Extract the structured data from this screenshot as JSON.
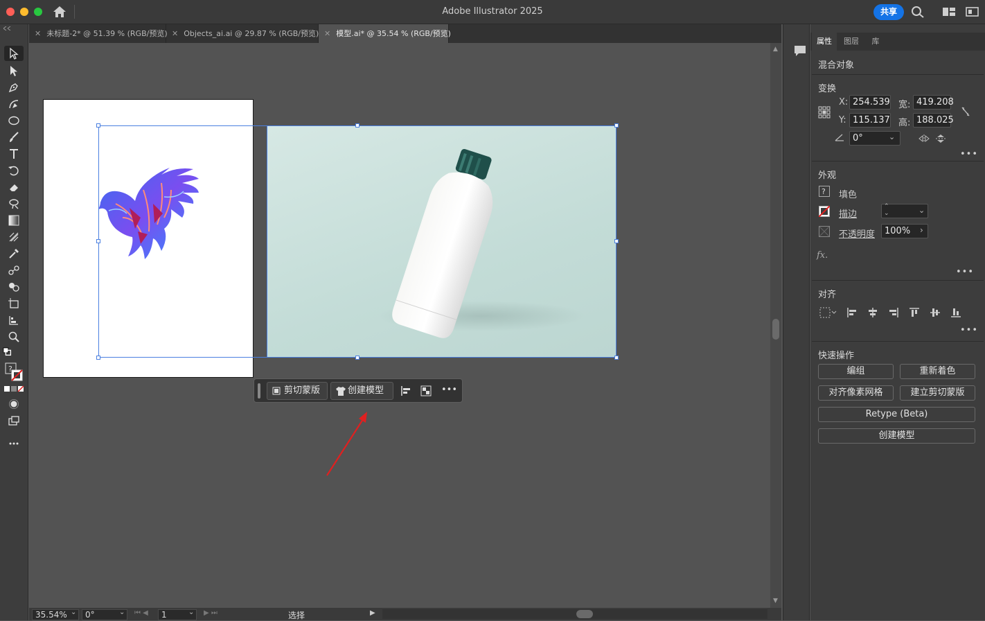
{
  "app": {
    "title": "Adobe Illustrator 2025",
    "share_label": "共享"
  },
  "tabs": [
    {
      "label": "未标题-2* @ 51.39 % (RGB/预览)"
    },
    {
      "label": "Objects_ai.ai @ 29.87 % (RGB/预览)"
    },
    {
      "label": "模型.ai* @ 35.54 % (RGB/预览)"
    }
  ],
  "context_bar": {
    "clip_mask": "剪切蒙版",
    "create_mockup": "创建模型",
    "more": "•••"
  },
  "panel": {
    "tabs": [
      "属性",
      "图层",
      "库"
    ],
    "object_type": "混合对象",
    "transform": {
      "title": "变换",
      "x_label": "X:",
      "x_value": "254.539",
      "y_label": "Y:",
      "y_value": "115.137",
      "w_label": "宽:",
      "w_value": "419.208",
      "h_label": "高:",
      "h_value": "188.025",
      "angle_value": "0°"
    },
    "appearance": {
      "title": "外观",
      "fill_label": "填色",
      "stroke_label": "描边",
      "opacity_label": "不透明度",
      "opacity_value": "100%",
      "fx_label": "fx."
    },
    "align": {
      "title": "对齐"
    },
    "quick_actions": {
      "title": "快速操作",
      "group": "编组",
      "recolor": "重新着色",
      "pixel_grid": "对齐像素网格",
      "make_clip_mask": "建立剪切蒙版",
      "retype": "Retype (Beta)",
      "create_mockup": "创建模型"
    },
    "more": "•••"
  },
  "statusbar": {
    "zoom": "35.54%",
    "rotate": "0°",
    "artboard": "1",
    "tool": "选择"
  },
  "colors": {
    "accent": "#1473e6",
    "selection": "#4a7fe0",
    "mockup_bg": "#c9e0dc",
    "arrow": "#e02020"
  }
}
